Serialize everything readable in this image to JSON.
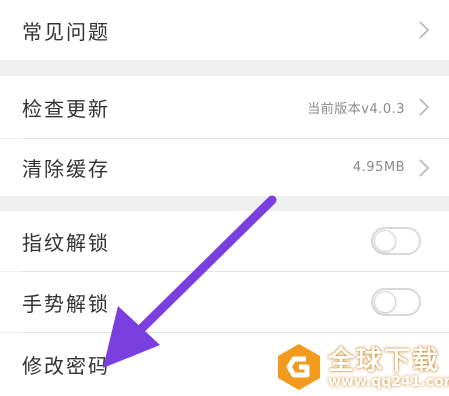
{
  "settings": {
    "faq": {
      "label": "常见问题"
    },
    "check_update": {
      "label": "检查更新",
      "value": "当前版本v4.0.3"
    },
    "clear_cache": {
      "label": "清除缓存",
      "value": "4.95MB"
    },
    "fingerprint_unlock": {
      "label": "指纹解锁",
      "enabled": false
    },
    "gesture_unlock": {
      "label": "手势解锁",
      "enabled": false
    },
    "change_password": {
      "label": "修改密码"
    }
  },
  "watermark": {
    "title": "全球下载",
    "url": "www.qq241.com"
  },
  "colors": {
    "background": "#efefef",
    "row": "#ffffff",
    "text": "#333333",
    "secondary_text": "#8a8a8a",
    "arrow": "#7b3fe0",
    "watermark_orange": "#f29a1d"
  },
  "icons": [
    "chevron-right-icon",
    "toggle-switch",
    "annotation-arrow",
    "watermark-logo-icon"
  ]
}
